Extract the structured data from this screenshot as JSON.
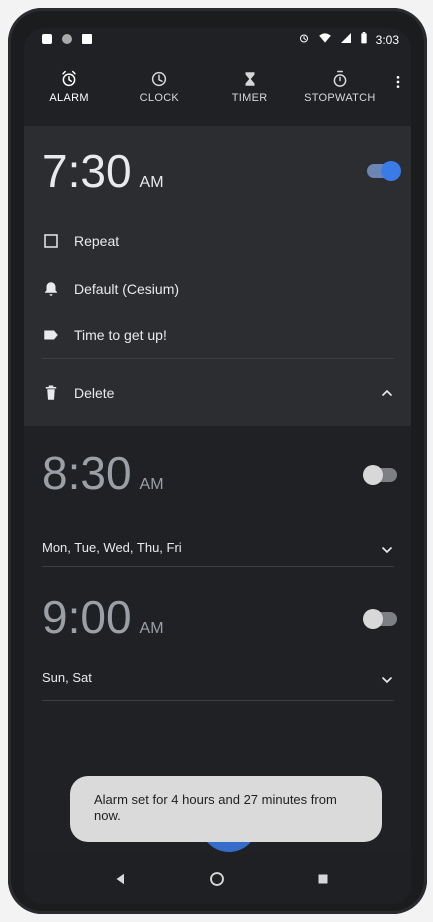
{
  "status_bar": {
    "time": "3:03"
  },
  "tabs": [
    {
      "label": "ALARM",
      "icon": "alarm-icon",
      "active": true
    },
    {
      "label": "CLOCK",
      "icon": "clock-icon",
      "active": false
    },
    {
      "label": "TIMER",
      "icon": "hourglass-icon",
      "active": false
    },
    {
      "label": "STOPWATCH",
      "icon": "stopwatch-icon",
      "active": false
    }
  ],
  "alarms": [
    {
      "time": "7:30",
      "ampm": "AM",
      "enabled": true,
      "expanded": true,
      "options": {
        "repeat_label": "Repeat",
        "ringtone_label": "Default (Cesium)",
        "label_text": "Time to get up!",
        "delete_label": "Delete"
      }
    },
    {
      "time": "8:30",
      "ampm": "AM",
      "enabled": false,
      "days": "Mon, Tue, Wed, Thu, Fri"
    },
    {
      "time": "9:00",
      "ampm": "AM",
      "enabled": false,
      "days": "Sun, Sat"
    }
  ],
  "toast": {
    "message": "Alarm set for 4 hours and 27 minutes from now."
  },
  "colors": {
    "accent": "#3b7be8",
    "background": "#202124",
    "expanded_card": "#2b2d31"
  }
}
